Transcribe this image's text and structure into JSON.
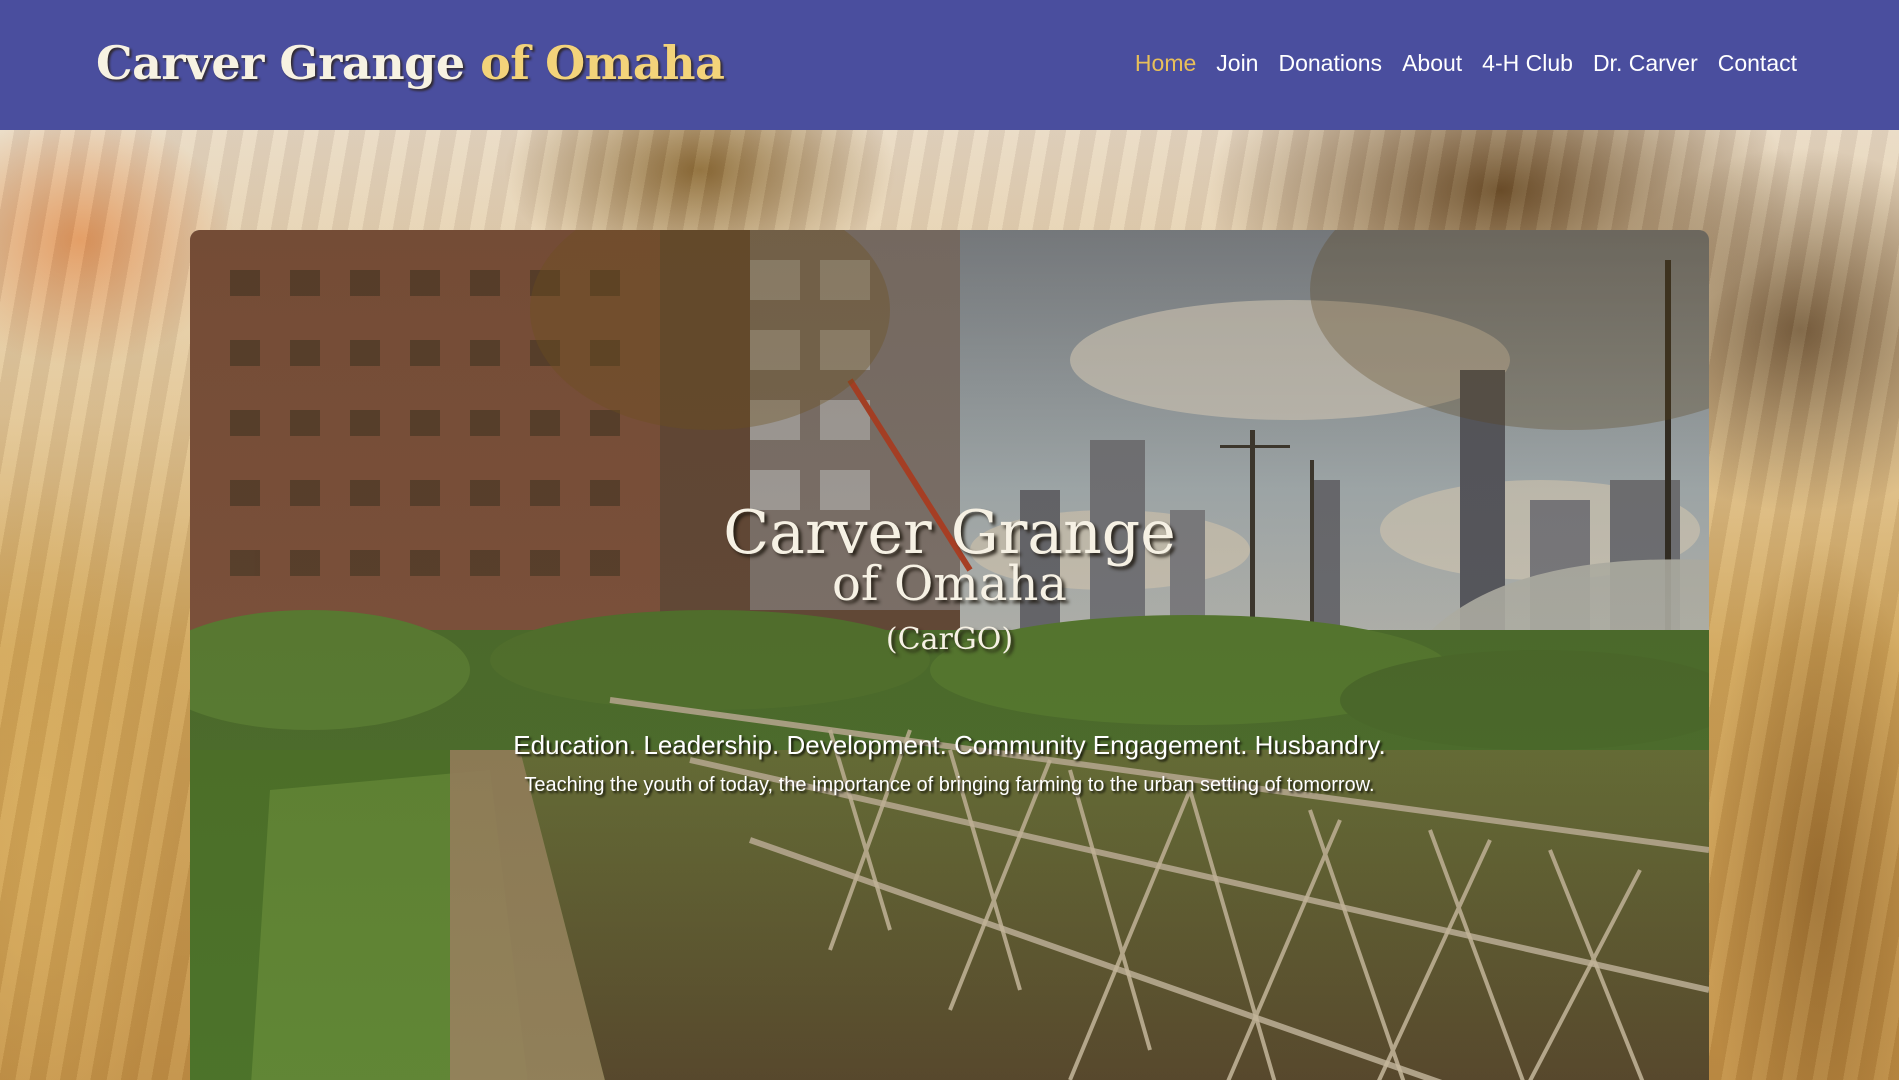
{
  "header": {
    "brand_part1": "Carver Grange",
    "brand_part2": " of Omaha",
    "nav": [
      {
        "label": "Home",
        "active": true
      },
      {
        "label": "Join",
        "active": false
      },
      {
        "label": "Donations",
        "active": false
      },
      {
        "label": "About",
        "active": false
      },
      {
        "label": "4-H Club",
        "active": false
      },
      {
        "label": "Dr. Carver",
        "active": false
      },
      {
        "label": "Contact",
        "active": false
      }
    ]
  },
  "hero": {
    "title": "Carver Grange",
    "subtitle": "of Omaha",
    "abbreviation": "(CarGO)",
    "tagline": "Education. Leadership. Development. Community Engagement. Husbandry.",
    "description": "Teaching the youth of today, the importance of bringing farming to the urban setting of tomorrow."
  },
  "colors": {
    "header_bg": "#4a4e9e",
    "nav_active": "#e7bf5a",
    "nav_text": "#ffffff",
    "brand_accent": "#f3d37a"
  }
}
